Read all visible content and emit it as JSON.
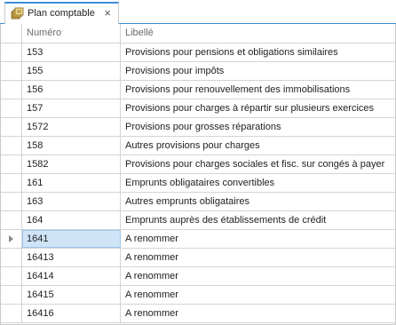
{
  "tab": {
    "label": "Plan comptable",
    "close": "×",
    "icon": "ledger-icon"
  },
  "columns": {
    "numero": "Numéro",
    "libelle": "Libellé"
  },
  "selected_index": 10,
  "rows": [
    {
      "numero": "153",
      "libelle": "Provisions pour pensions et obligations similaires"
    },
    {
      "numero": "155",
      "libelle": "Provisions pour impôts"
    },
    {
      "numero": "156",
      "libelle": "Provisions pour renouvellement des immobilisations"
    },
    {
      "numero": "157",
      "libelle": "Provisions pour charges à répartir sur plusieurs exercices"
    },
    {
      "numero": "1572",
      "libelle": "Provisions pour grosses réparations"
    },
    {
      "numero": "158",
      "libelle": "Autres provisions pour charges"
    },
    {
      "numero": "1582",
      "libelle": "Provisions pour charges sociales et fisc. sur congés à payer"
    },
    {
      "numero": "161",
      "libelle": "Emprunts obligataires convertibles"
    },
    {
      "numero": "163",
      "libelle": "Autres emprunts obligataires"
    },
    {
      "numero": "164",
      "libelle": "Emprunts auprès des établissements de crédit"
    },
    {
      "numero": "1641",
      "libelle": "A renommer"
    },
    {
      "numero": "16413",
      "libelle": "A renommer"
    },
    {
      "numero": "16414",
      "libelle": "A renommer"
    },
    {
      "numero": "16415",
      "libelle": "A renommer"
    },
    {
      "numero": "16416",
      "libelle": "A renommer"
    }
  ]
}
